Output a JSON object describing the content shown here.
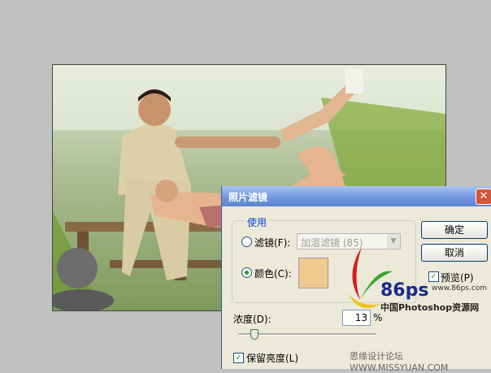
{
  "dialog": {
    "title": "照片滤镜",
    "close": "✕",
    "use_group": "使用",
    "filter_label": "滤镜(F):",
    "filter_value": "加温滤镜 (85)",
    "color_label": "颜色(C):",
    "swatch_color": "#f0c98e",
    "ok": "确定",
    "cancel": "取消",
    "preview": "预览(P)",
    "density_label": "浓度(D):",
    "density_value": "13",
    "density_unit": "%",
    "density_level_percent": 13,
    "preserve": "保留亮度(L)"
  },
  "watermark": {
    "logo_text": "86ps",
    "url": "www.86ps.com",
    "site_cn": "中国Photoshop资源网",
    "forum": "思缘设计论坛 WWW.MISSYUAN.COM"
  },
  "colors": {
    "accent": "#0046d5",
    "radio_dot": "#21a121",
    "title_gradient": "#5d84d3"
  }
}
